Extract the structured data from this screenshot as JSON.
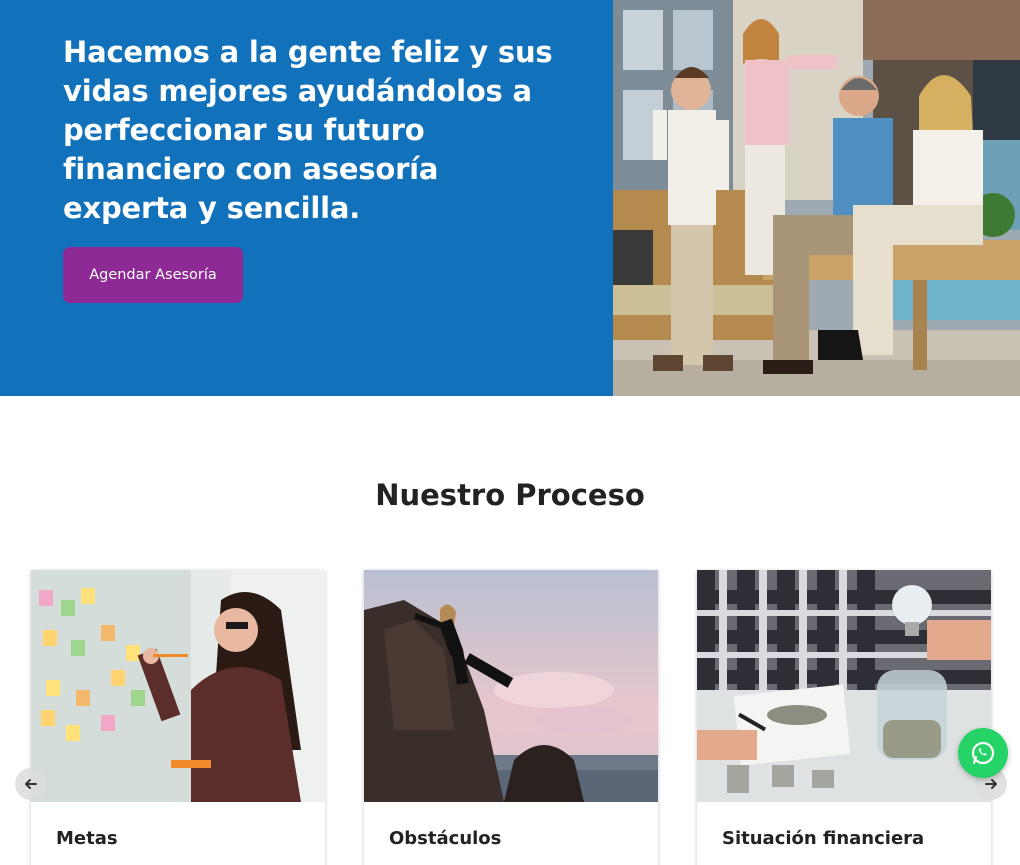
{
  "hero": {
    "headline": "Hacemos a la gente feliz y sus vidas mejores ayudándolos a perfeccionar su futuro financiero con asesoría experta y sencilla.",
    "cta_label": "Agendar Asesoría",
    "image_alt": "family-photo"
  },
  "process": {
    "title": "Nuestro Proceso",
    "cards": [
      {
        "title": "Metas"
      },
      {
        "title": "Obstáculos"
      },
      {
        "title": "Situación financiera"
      }
    ]
  },
  "colors": {
    "hero_blue": "#1171bb",
    "cta_purple": "#8e2a95",
    "whatsapp_green": "#25d366"
  },
  "icons": {
    "prev": "arrow-left-icon",
    "next": "arrow-right-icon",
    "whatsapp": "whatsapp-icon"
  }
}
